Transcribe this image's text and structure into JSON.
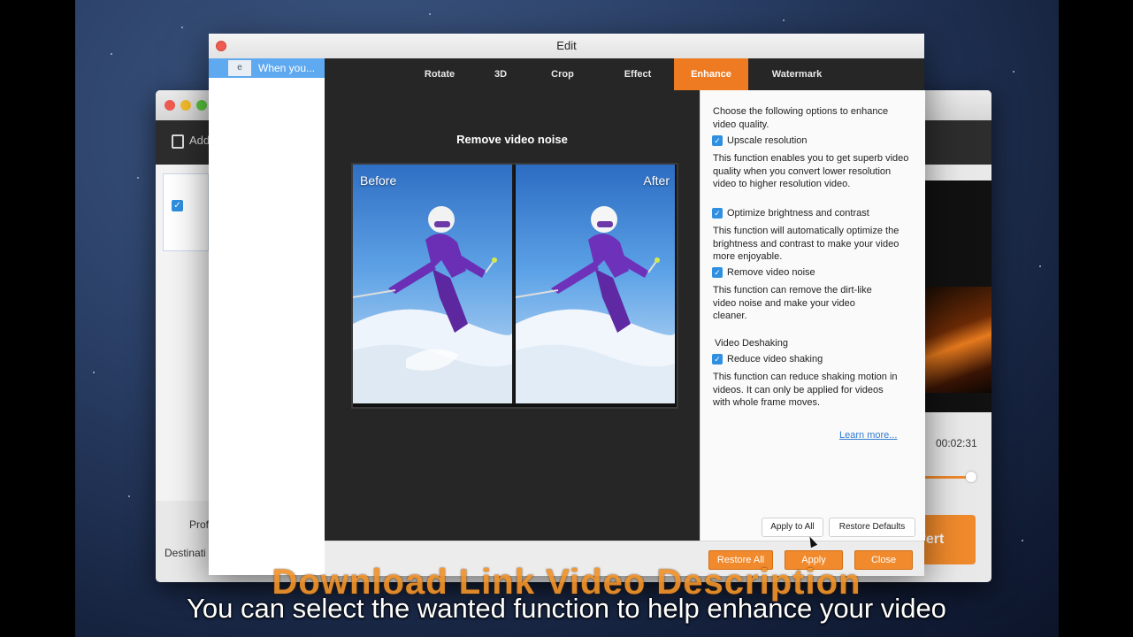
{
  "dialog": {
    "title": "Edit",
    "sidebar_item": "When you..."
  },
  "tabs": [
    {
      "label": "Rotate"
    },
    {
      "label": "3D"
    },
    {
      "label": "Crop"
    },
    {
      "label": "Effect"
    },
    {
      "label": "Enhance"
    },
    {
      "label": "Watermark"
    }
  ],
  "preview": {
    "heading": "Remove video noise",
    "before_label": "Before",
    "after_label": "After"
  },
  "options": {
    "intro": "Choose the following options to enhance video quality.",
    "upscale_label": "Upscale resolution",
    "upscale_desc": "This function enables you to get superb video quality when you convert lower resolution video to higher resolution video.",
    "brightness_label": "Optimize brightness and contrast",
    "brightness_desc": "This function will automatically optimize the brightness and contrast to make your video more enjoyable.",
    "noise_label": "Remove video noise",
    "noise_desc": "This function can remove the dirt-like video noise and make your video cleaner.",
    "deshake_heading": "Video Deshaking",
    "shake_label": "Reduce video shaking",
    "shake_desc": "This function can reduce shaking motion in videos. It can only be applied for videos with whole frame moves.",
    "learn_more": "Learn more...",
    "apply_to_all": "Apply to All",
    "restore_defaults": "Restore Defaults"
  },
  "bottom": {
    "restore_all": "Restore All",
    "apply": "Apply",
    "close": "Close"
  },
  "background_app": {
    "add_label": "Add",
    "time": "00:02:31",
    "profile_label": "Prof",
    "destination_label": "Destinati",
    "convert_label": "vert"
  },
  "captions": {
    "overlay": "Download Link Video Description",
    "subtitle": "You can select the wanted function to help enhance your video"
  },
  "colors": {
    "accent": "#ee7a22",
    "checkbox": "#2f8fe0",
    "tab_bar": "#262626"
  }
}
